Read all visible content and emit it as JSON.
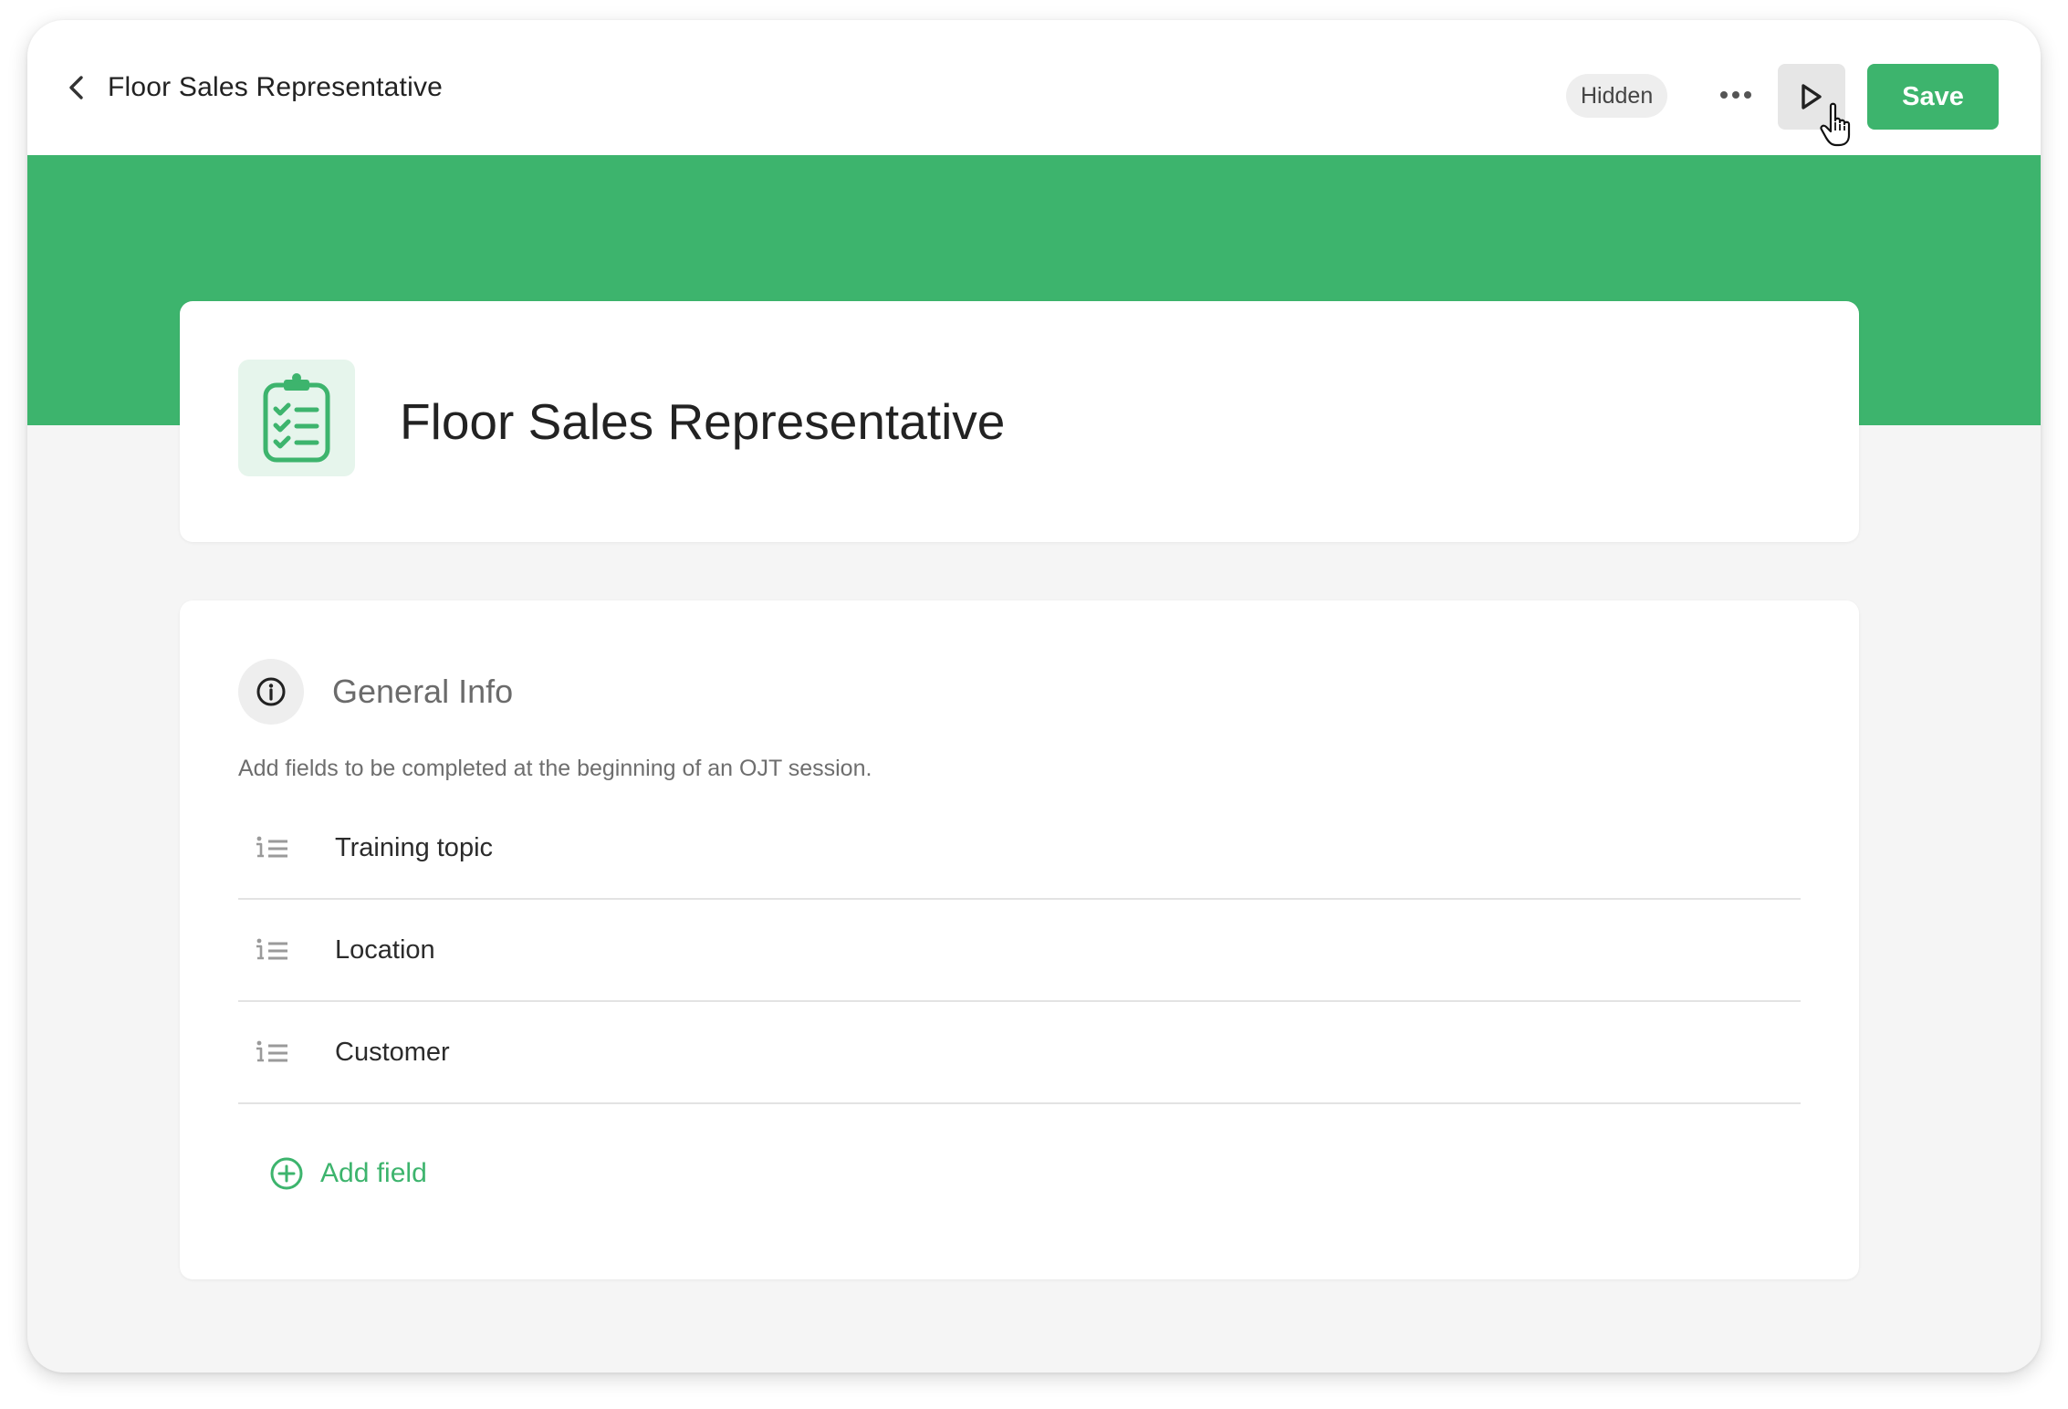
{
  "header": {
    "title": "Floor Sales Representative",
    "status_badge": "Hidden",
    "save_label": "Save"
  },
  "title_card": {
    "title": "Floor Sales Representative",
    "icon": "clipboard-checklist-icon"
  },
  "general_info": {
    "title": "General Info",
    "description": "Add fields to be completed at the beginning of an OJT session.",
    "fields": [
      {
        "label": "Training topic",
        "icon": "list-icon"
      },
      {
        "label": "Location",
        "icon": "list-icon"
      },
      {
        "label": "Customer",
        "icon": "list-icon"
      }
    ],
    "add_field_label": "Add field"
  },
  "colors": {
    "accent": "#3db46d",
    "accent_light": "#e6f5ec",
    "background": "#f5f5f5"
  }
}
